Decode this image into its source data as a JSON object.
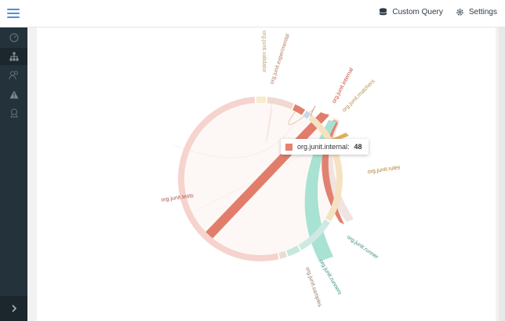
{
  "header": {
    "custom_query_label": "Custom Query",
    "settings_label": "Settings"
  },
  "sidebar": {
    "items": [
      {
        "icon": "dashboard-gauge-icon"
      },
      {
        "icon": "hierarchy-icon"
      },
      {
        "icon": "users-icon"
      },
      {
        "icon": "warning-icon"
      },
      {
        "icon": "award-icon"
      }
    ],
    "expand_icon": "chevron-right-icon"
  },
  "chart_data": {
    "type": "chord",
    "groups": [
      {
        "name": "org.junit.validator",
        "color": "#e6d9a6"
      },
      {
        "name": "org.junit.experimental",
        "color": "#d9a48b"
      },
      {
        "name": "org.junit.internal",
        "color": "#e07b6a"
      },
      {
        "name": "org.junit.matchers",
        "color": "#d9a441"
      },
      {
        "name": "org.junit.rules",
        "color": "#d9a441"
      },
      {
        "name": "org.junit.runner",
        "color": "#4dab9a"
      },
      {
        "name": "org.junit.runners",
        "color": "#3a9a86"
      },
      {
        "name": "org.junit.samples",
        "color": "#b79a86"
      },
      {
        "name": "org.junit.tests",
        "color": "#c0504d"
      }
    ],
    "tooltip": {
      "label": "org.junit.internal:",
      "value": 48,
      "color": "#e8806e"
    }
  }
}
